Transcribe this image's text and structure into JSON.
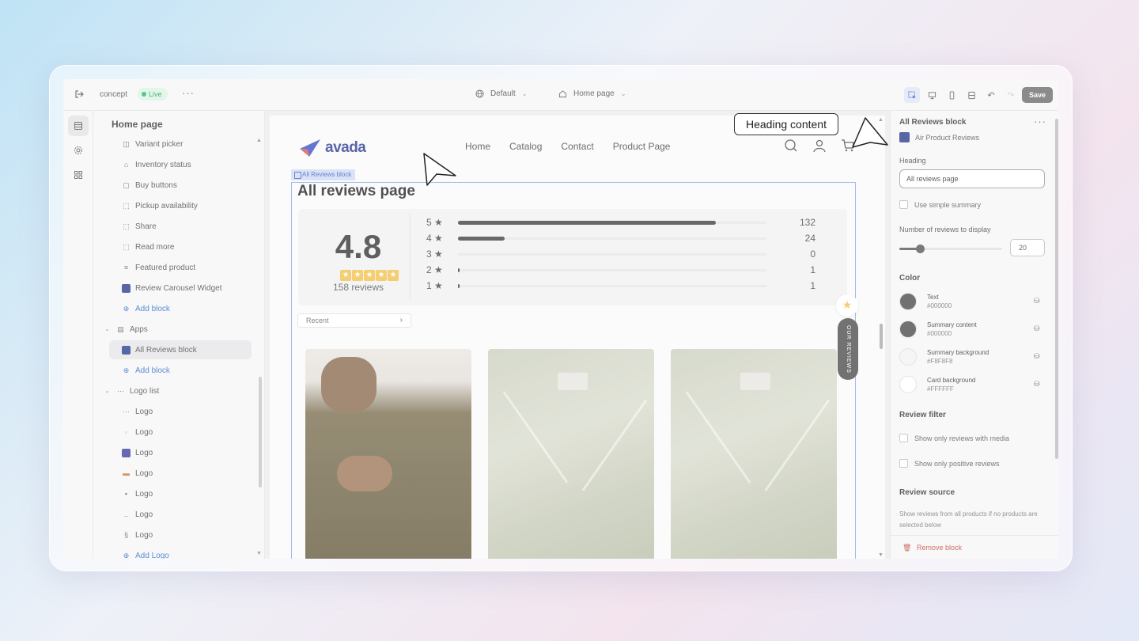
{
  "topbar": {
    "store_name": "concept",
    "live_badge": "Live",
    "more": "···",
    "theme_select": "Default",
    "page_select": "Home page",
    "save_label": "Save"
  },
  "sidebar": {
    "title": "Home page",
    "items": [
      {
        "label": "Variant picker",
        "icon": "variant-icon"
      },
      {
        "label": "Inventory status",
        "icon": "inventory-icon"
      },
      {
        "label": "Buy buttons",
        "icon": "buy-icon"
      },
      {
        "label": "Pickup availability",
        "icon": "pickup-icon"
      },
      {
        "label": "Share",
        "icon": "share-icon"
      },
      {
        "label": "Read more",
        "icon": "read-more-icon"
      },
      {
        "label": "Featured product",
        "icon": "featured-icon"
      },
      {
        "label": "Review Carousel Widget",
        "icon": "app-icon"
      },
      {
        "label": "Add block",
        "icon": "plus-circle-icon"
      }
    ],
    "apps_group": "Apps",
    "apps_items": [
      {
        "label": "All Reviews block",
        "icon": "app-icon"
      },
      {
        "label": "Add block",
        "icon": "plus-circle-icon"
      }
    ],
    "logo_group": "Logo list",
    "logo_items": [
      "Logo",
      "Logo",
      "Logo",
      "Logo",
      "Logo",
      "Logo",
      "Logo"
    ],
    "add_logo": "Add Logo"
  },
  "preview": {
    "brand": "avada",
    "nav": [
      "Home",
      "Catalog",
      "Contact",
      "Product Page"
    ],
    "block_tag": "All Reviews block",
    "heading": "All reviews page",
    "rating": "4.8",
    "review_count": "158 reviews",
    "distribution": [
      {
        "stars": "5 ★",
        "count": "132",
        "value": 132
      },
      {
        "stars": "4 ★",
        "count": "24",
        "value": 24
      },
      {
        "stars": "3 ★",
        "count": "0",
        "value": 0
      },
      {
        "stars": "2 ★",
        "count": "1",
        "value": 1
      },
      {
        "stars": "1 ★",
        "count": "1",
        "value": 1
      }
    ],
    "sort_label": "Recent",
    "floating_tab": "OUR REVIEWS"
  },
  "right_panel": {
    "title": "All Reviews block",
    "app_name": "Air Product Reviews",
    "heading_label": "Heading",
    "heading_value": "All reviews page",
    "simple_summary": "Use simple summary",
    "num_reviews_label": "Number of reviews to display",
    "num_reviews_value": "20",
    "num_reviews_fraction": 0.2,
    "color_label": "Color",
    "colors": [
      {
        "name": "Text",
        "hex": "#000000",
        "swatch": "#4a4a4a"
      },
      {
        "name": "Summary content",
        "hex": "#000000",
        "swatch": "#4a4a4a"
      },
      {
        "name": "Summary background",
        "hex": "#F8F8F8",
        "swatch": "#f3f3f3"
      },
      {
        "name": "Card background",
        "hex": "#FFFFFF",
        "swatch": "#ffffff"
      }
    ],
    "filter_label": "Review filter",
    "filter_media": "Show only reviews with media",
    "filter_positive": "Show only positive reviews",
    "source_label": "Review source",
    "source_help": "Show reviews from all products if no products are selected below",
    "remove_label": "Remove block"
  },
  "callout": {
    "text": "Heading content"
  }
}
